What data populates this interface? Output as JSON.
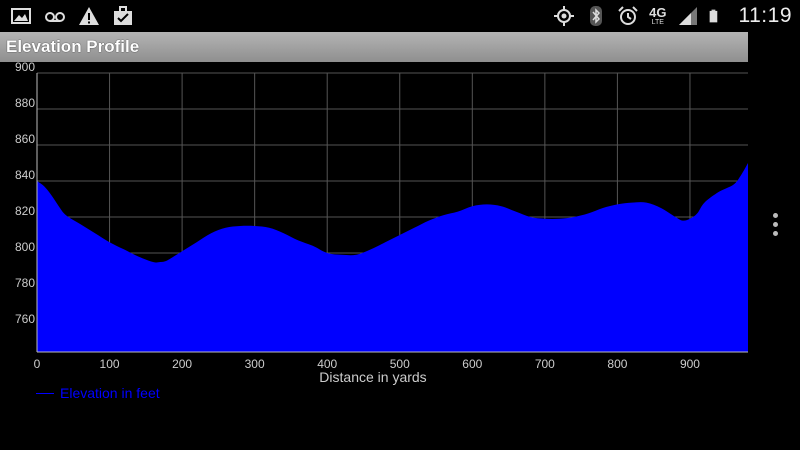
{
  "status_bar": {
    "time": "11:19",
    "network": "4G",
    "network_sub": "LTE",
    "left_icons": [
      "gallery-icon",
      "voicemail-icon",
      "warning-icon",
      "briefcase-icon"
    ],
    "right_icons": [
      "gps-icon",
      "bluetooth-icon",
      "alarm-icon",
      "signal-icon",
      "battery-icon"
    ]
  },
  "app": {
    "title": "Elevation Profile"
  },
  "colors": {
    "fill": "#0000ff",
    "grid": "#555555",
    "axis_text": "#cccccc",
    "title_bar": "#a0a0a0"
  },
  "chart_data": {
    "type": "area",
    "title": "",
    "xlabel": "Distance in yards",
    "ylabel": "",
    "xlim": [
      0,
      980
    ],
    "ylim": [
      745,
      900
    ],
    "xticks": [
      0,
      100,
      200,
      300,
      400,
      500,
      600,
      700,
      800,
      900
    ],
    "yticks": [
      760,
      780,
      800,
      820,
      840,
      860,
      880,
      900
    ],
    "grid": true,
    "legend_position": "bottom-left",
    "series": [
      {
        "name": "Elevation in feet",
        "x": [
          0,
          10,
          20,
          30,
          40,
          60,
          80,
          100,
          120,
          140,
          160,
          170,
          180,
          200,
          220,
          240,
          260,
          280,
          300,
          320,
          340,
          360,
          380,
          400,
          420,
          440,
          460,
          480,
          500,
          520,
          540,
          560,
          580,
          600,
          620,
          640,
          660,
          680,
          700,
          720,
          740,
          760,
          780,
          800,
          820,
          840,
          860,
          880,
          890,
          900,
          910,
          920,
          940,
          960,
          970,
          980
        ],
        "y": [
          840,
          837,
          832,
          826,
          821,
          816,
          811,
          806,
          802,
          798,
          795,
          795,
          796,
          801,
          806,
          811,
          814,
          815,
          815,
          814,
          811,
          807,
          804,
          800,
          799,
          799,
          802,
          806,
          810,
          814,
          818,
          821,
          823,
          826,
          827,
          826,
          823,
          820,
          819,
          819,
          820,
          822,
          825,
          827,
          828,
          828,
          825,
          820,
          818,
          819,
          822,
          828,
          834,
          838,
          843,
          850
        ]
      }
    ]
  }
}
